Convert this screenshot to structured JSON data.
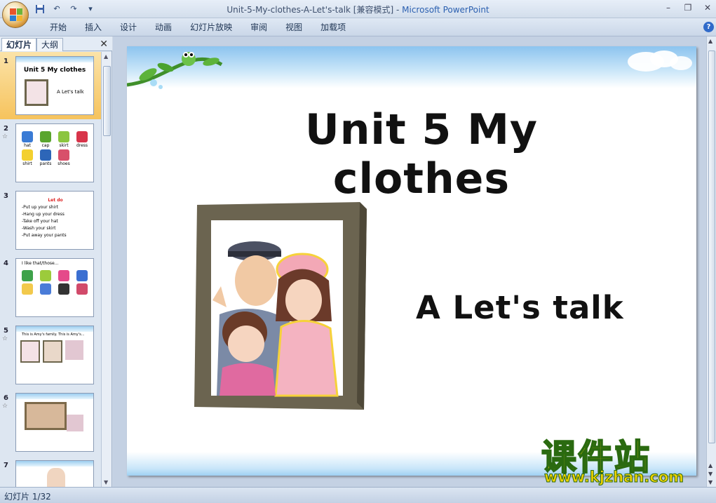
{
  "window": {
    "title": "Unit-5-My-clothes-A-Let's-talk [兼容模式]",
    "title_sep": " - ",
    "app_name": "Microsoft PowerPoint"
  },
  "quick_access": {
    "save_icon": "save-icon",
    "undo_icon": "undo-icon",
    "redo_icon": "redo-icon"
  },
  "ribbon": {
    "tabs": [
      "开始",
      "插入",
      "设计",
      "动画",
      "幻灯片放映",
      "审阅",
      "视图",
      "加载项"
    ]
  },
  "pane": {
    "tabs": {
      "slides": "幻灯片",
      "outline": "大纲"
    },
    "thumbnails": [
      {
        "num": "1",
        "title": "Unit 5  My clothes",
        "sub": "A Let's talk"
      },
      {
        "num": "2",
        "items": [
          "hat",
          "cap",
          "skirt",
          "dress",
          "shirt",
          "pants",
          "shoes"
        ]
      },
      {
        "num": "3",
        "heading": "Let do",
        "lines": [
          "-Put up your shirt",
          "-Hang up your dress",
          "-Take off your hat",
          "-Wash your skirt",
          "-Put away your pants"
        ]
      },
      {
        "num": "4",
        "heading": "I like  that/those..."
      },
      {
        "num": "5",
        "heading": "This is Amy's family.  This is Amy's..."
      },
      {
        "num": "6"
      },
      {
        "num": "7"
      }
    ]
  },
  "slide": {
    "title": "Unit 5  My clothes",
    "subtitle": "A Let's talk"
  },
  "status": {
    "slide_counter": "幻灯片 1/32"
  },
  "watermark": {
    "brand": "课件站",
    "url": "www.kjzhan.com"
  },
  "colors": {
    "accent": "#2a5fb0",
    "selected_thumb": "#f6c35d",
    "watermark_yellow": "#f2d400"
  }
}
